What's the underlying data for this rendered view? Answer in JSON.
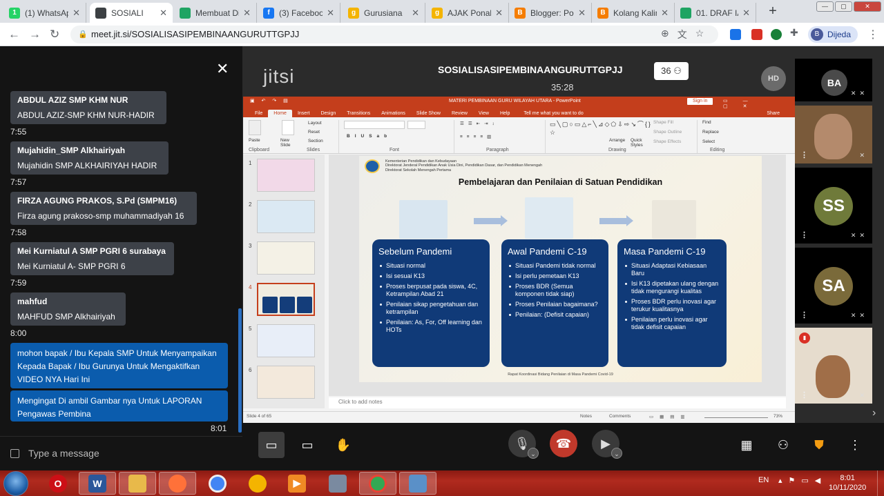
{
  "browser": {
    "tabs": [
      {
        "title": "(1) WhatsAp",
        "icon": "whatsapp-icon",
        "color": "#25d366",
        "glyph": "1",
        "active": false
      },
      {
        "title": "SOSIALI",
        "icon": "jitsi-icon",
        "color": "#ffffff",
        "glyph": "",
        "active": true
      },
      {
        "title": "Membuat Di",
        "icon": "google-drive-icon",
        "color": "#1fa463",
        "glyph": "",
        "active": false
      },
      {
        "title": "(3) Faceboo",
        "icon": "facebook-icon",
        "color": "#1877f2",
        "glyph": "f",
        "active": false
      },
      {
        "title": "Gurusiana",
        "icon": "gurusiana-icon",
        "color": "#f4b400",
        "glyph": "g",
        "active": false
      },
      {
        "title": "AJAK Ponak",
        "icon": "gurusiana-icon",
        "color": "#f4b400",
        "glyph": "g",
        "active": false
      },
      {
        "title": "Blogger: Po",
        "icon": "blogger-icon",
        "color": "#f57d00",
        "glyph": "B",
        "active": false
      },
      {
        "title": "Kolang Kalin",
        "icon": "blogger-icon",
        "color": "#f57d00",
        "glyph": "B",
        "active": false
      },
      {
        "title": "01. DRAF IA",
        "icon": "google-drive-icon",
        "color": "#1fa463",
        "glyph": "",
        "active": false
      }
    ],
    "url": "meet.jit.si/SOSIALISASIPEMBINAANGURUTTGPJJ",
    "profile_name": "Dijeda",
    "profile_initial": "B"
  },
  "chat": {
    "messages": [
      {
        "sender": "ABDUL AZIZ SMP KHM NUR",
        "text": "ABDUL AZIZ-SMP KHM NUR-HADIR",
        "time": "7:55"
      },
      {
        "sender": "Mujahidin_SMP Alkhairiyah",
        "text": "Mujahidin SMP ALKHAIRIYAH HADIR",
        "time": "7:57"
      },
      {
        "sender": "FIRZA AGUNG PRAKOS, S.Pd (SMPM16)",
        "text": "Firza agung prakoso-smp muhammadiyah 16",
        "time": "7:58"
      },
      {
        "sender": "Mei Kurniatul A SMP PGRI 6 surabaya",
        "text": "Mei Kurniatul A- SMP PGRI 6",
        "time": "7:59"
      },
      {
        "sender": "mahfud",
        "text": "MAHFUD SMP Alkhairiyah",
        "time": "8:00"
      }
    ],
    "own_messages": [
      "mohon  bapak / Ibu Kepala SMP Untuk Menyampaikan Kepada Bapak / Ibu Gurunya Untuk Mengaktifkan VIDEO NYA Hari Ini",
      "Mengingat Di ambil Gambar nya Untuk LAPORAN Pengawas Pembina"
    ],
    "own_time": "8:01",
    "input_placeholder": "Type a message"
  },
  "conference": {
    "logo_text": "jitsi",
    "room_name": "SOSIALISASIPEMBINAANGURUTTGPJJ",
    "participant_count": "36",
    "timer": "35:28",
    "hd_label": "HD"
  },
  "powerpoint": {
    "window_title": "MATERI PEMBINAAN GURU  WILAYAH UTARA  -  PowerPoint",
    "sign_in": "Sign in",
    "tabs": [
      "File",
      "Home",
      "Insert",
      "Design",
      "Transitions",
      "Animations",
      "Slide Show",
      "Review",
      "View",
      "Help"
    ],
    "tell_me": "Tell me what you want to do",
    "share": "Share",
    "groups": [
      "Clipboard",
      "Slides",
      "Font",
      "Paragraph",
      "Drawing",
      "Editing"
    ],
    "ribbon_labels": {
      "paste": "Paste",
      "new_slide": "New Slide",
      "layout": "Layout",
      "reset": "Reset",
      "section": "Section",
      "arrange": "Arrange",
      "quick_styles": "Quick Styles",
      "shape_fill": "Shape Fill",
      "shape_outline": "Shape Outline",
      "shape_effects": "Shape Effects",
      "find": "Find",
      "replace": "Replace",
      "select": "Select"
    },
    "thumb_numbers": [
      "1",
      "2",
      "3",
      "4",
      "5",
      "6"
    ],
    "selected_slide": "4",
    "notes_placeholder": "Click to add notes",
    "status_left": "Slide 4 of 65",
    "status_notes": "Notes",
    "status_comments": "Comments",
    "zoom": "73%"
  },
  "slide": {
    "ministry_lines": [
      "Kementerian Pendidikan dan Kebudayaan",
      "Direktorat Jenderal Pendidikan Anak Usia Dini, Pendidikan Dasar, dan Pendidikan Menengah",
      "Direktorat Sekolah Menengah Pertama"
    ],
    "title": "Pembelajaran dan Penilaian di Satuan Pendidikan",
    "cards": [
      {
        "heading": "Sebelum Pandemi",
        "items": [
          "Situasi normal",
          "Isi sesuai K13",
          "Proses berpusat pada siswa, 4C, Ketrampilan Abad 21",
          "Penilaian sikap pengetahuan dan ketrampilan",
          "Penilaian: As, For, Off learning dan HOTs"
        ]
      },
      {
        "heading": "Awal Pandemi C-19",
        "items": [
          "Situasi Pandemi tidak normal",
          "Isi perlu pemetaan K13",
          "Proses BDR (Semua komponen tidak siap)",
          "Proses Penilaian bagaimana?",
          "Penilaian: (Defisit capaian)"
        ]
      },
      {
        "heading": "Masa Pandemi C-19",
        "items": [
          "Situasi Adaptasi Kebiasaan Baru",
          "Isi K13 dipetakan ulang dengan tidak mengurangi kualitas",
          "Proses BDR perlu inovasi agar terukur kualitasnya",
          "Penilaian perlu inovasi agar tidak defisit capaian"
        ]
      }
    ],
    "footer": "Rapat Koordinasi Bidang Penilaian di Masa Pandemi Covid-19"
  },
  "participants": [
    {
      "initials": "BA",
      "color": "#4a4a4a"
    },
    {
      "initials": "",
      "color": "#7a5a3a"
    },
    {
      "initials": "SS",
      "color": "#6f7a3a"
    },
    {
      "initials": "SA",
      "color": "#7a6a3a"
    },
    {
      "initials": "",
      "color": "#e6dccd"
    }
  ],
  "taskbar": {
    "language": "EN",
    "time": "8:01",
    "date": "10/11/2020"
  }
}
